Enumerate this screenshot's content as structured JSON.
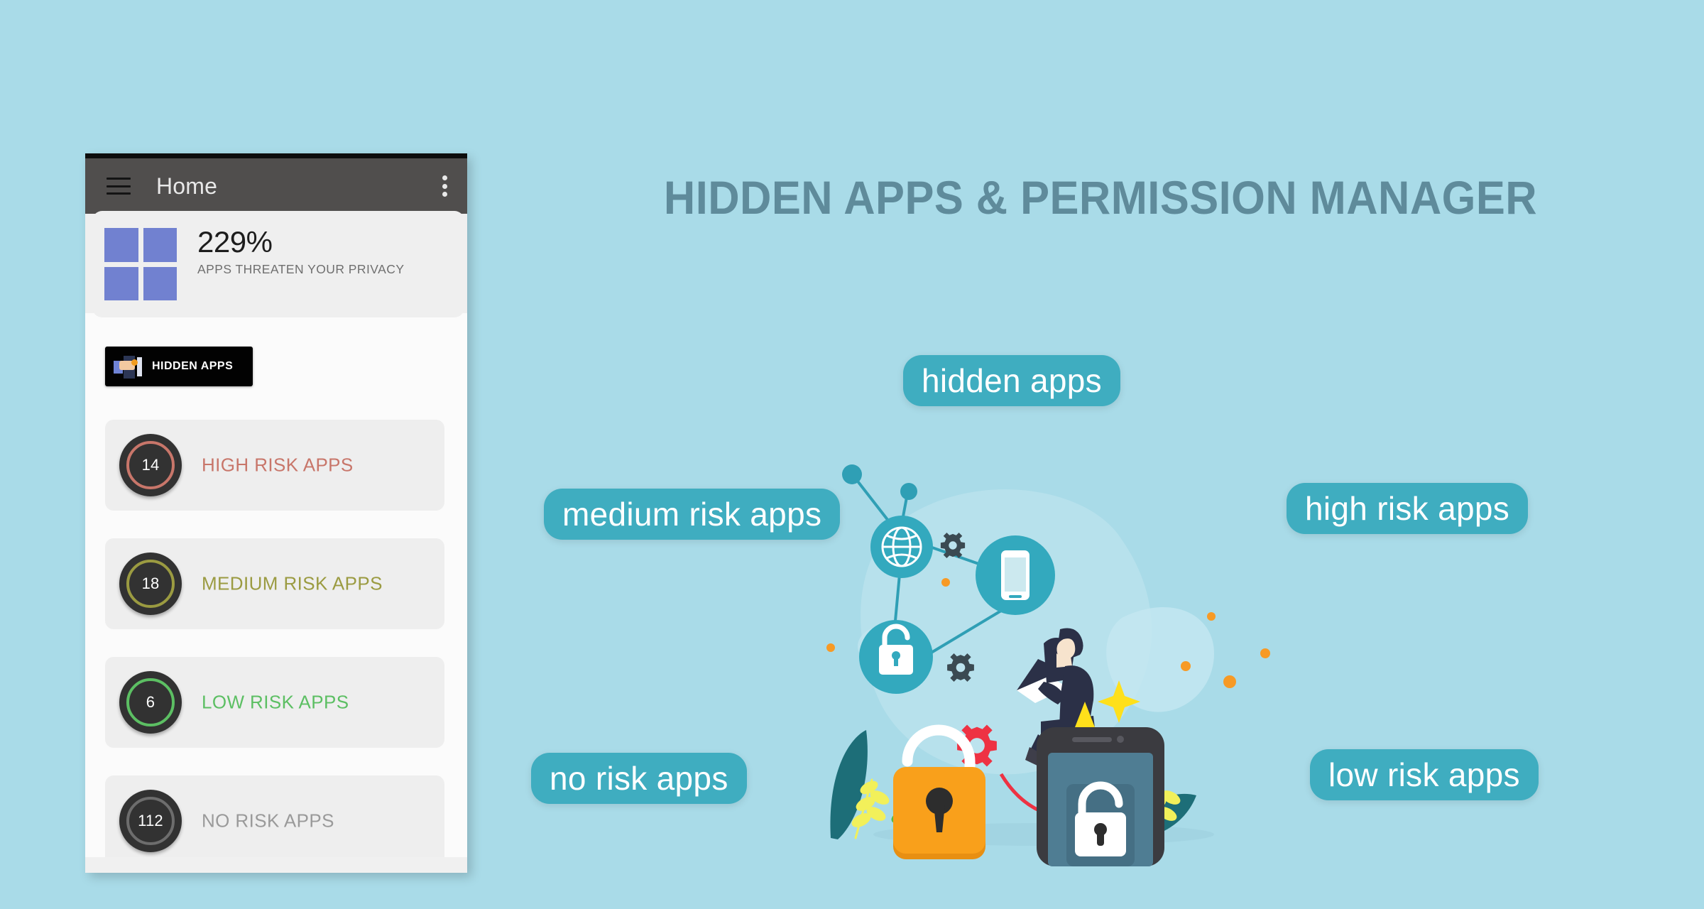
{
  "page": {
    "background_color": "#a9dbe8",
    "headline": "HIDDEN APPS & PERMISSION MANAGER",
    "headline_color": "#5f8b9b"
  },
  "app_panel": {
    "appbar": {
      "menu_icon": "hamburger-icon",
      "title": "Home",
      "overflow_icon": "more-vertical-icon"
    },
    "summary": {
      "icon": "apps-grid-icon",
      "icon_color": "#7181d0",
      "value": "229%",
      "caption": "APPS THREATEN YOUR PRIVACY"
    },
    "hidden_apps_chip": {
      "label": "HIDDEN APPS",
      "icon": "hidden-apps-thumbnail-icon",
      "background_color": "#020202"
    },
    "risk_list": [
      {
        "count": "14",
        "label": "HIGH RISK APPS",
        "accent": "#c8766a",
        "text_color": "#c8766a"
      },
      {
        "count": "18",
        "label": "MEDIUM RISK APPS",
        "accent": "#9b9b41",
        "text_color": "#9b9b41"
      },
      {
        "count": "6",
        "label": "LOW RISK APPS",
        "accent": "#5cbf63",
        "text_color": "#5cbf63"
      },
      {
        "count": "112",
        "label": "NO RISK APPS",
        "accent": "#6d6d6d",
        "text_color": "#9a9a9a"
      }
    ]
  },
  "pills": {
    "hidden": "hidden apps",
    "medium": "medium risk apps",
    "high": "high risk apps",
    "no": "no risk apps",
    "low": "low risk apps",
    "color": "#3fadc0"
  },
  "illustration": {
    "name": "security-privacy-illustration",
    "elements": [
      "network-globe-node",
      "network-phone-node",
      "network-lock-node",
      "gear-icon",
      "person-with-laptop",
      "red-gear-icon",
      "orange-padlock-icon",
      "smartphone-with-lock-screen",
      "leaf-decorations",
      "sparkle-icons"
    ],
    "colors": {
      "teal": "#33a9be",
      "orange": "#f5a01c",
      "red": "#ef3340",
      "dark": "#3b3b40",
      "yellow": "#ffe01b"
    }
  }
}
